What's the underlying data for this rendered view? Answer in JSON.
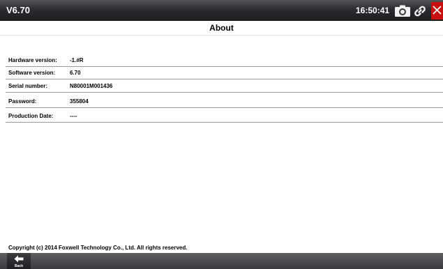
{
  "header": {
    "version": "V6.70",
    "time": "16:50:41",
    "icons": [
      "camera-icon",
      "link-icon",
      "close-icon"
    ]
  },
  "page": {
    "title": "About"
  },
  "info": [
    {
      "label": "Hardware version:",
      "value": "-1.#R"
    },
    {
      "label": "Software version:",
      "value": "6.70"
    },
    {
      "label": "Serial number:",
      "value": "N80001M001436"
    },
    {
      "label": "Password:",
      "value": "355804"
    },
    {
      "label": "Production Date:",
      "value": "----"
    }
  ],
  "footer": {
    "copyright": "Copyright (c) 2014 Foxwell Technology  Co., Ltd. All rights reserved.",
    "back_label": "Back"
  },
  "colors": {
    "close": "#c81010",
    "topbar": "#2c2c2e",
    "bottombar": "#4a4a4c"
  }
}
